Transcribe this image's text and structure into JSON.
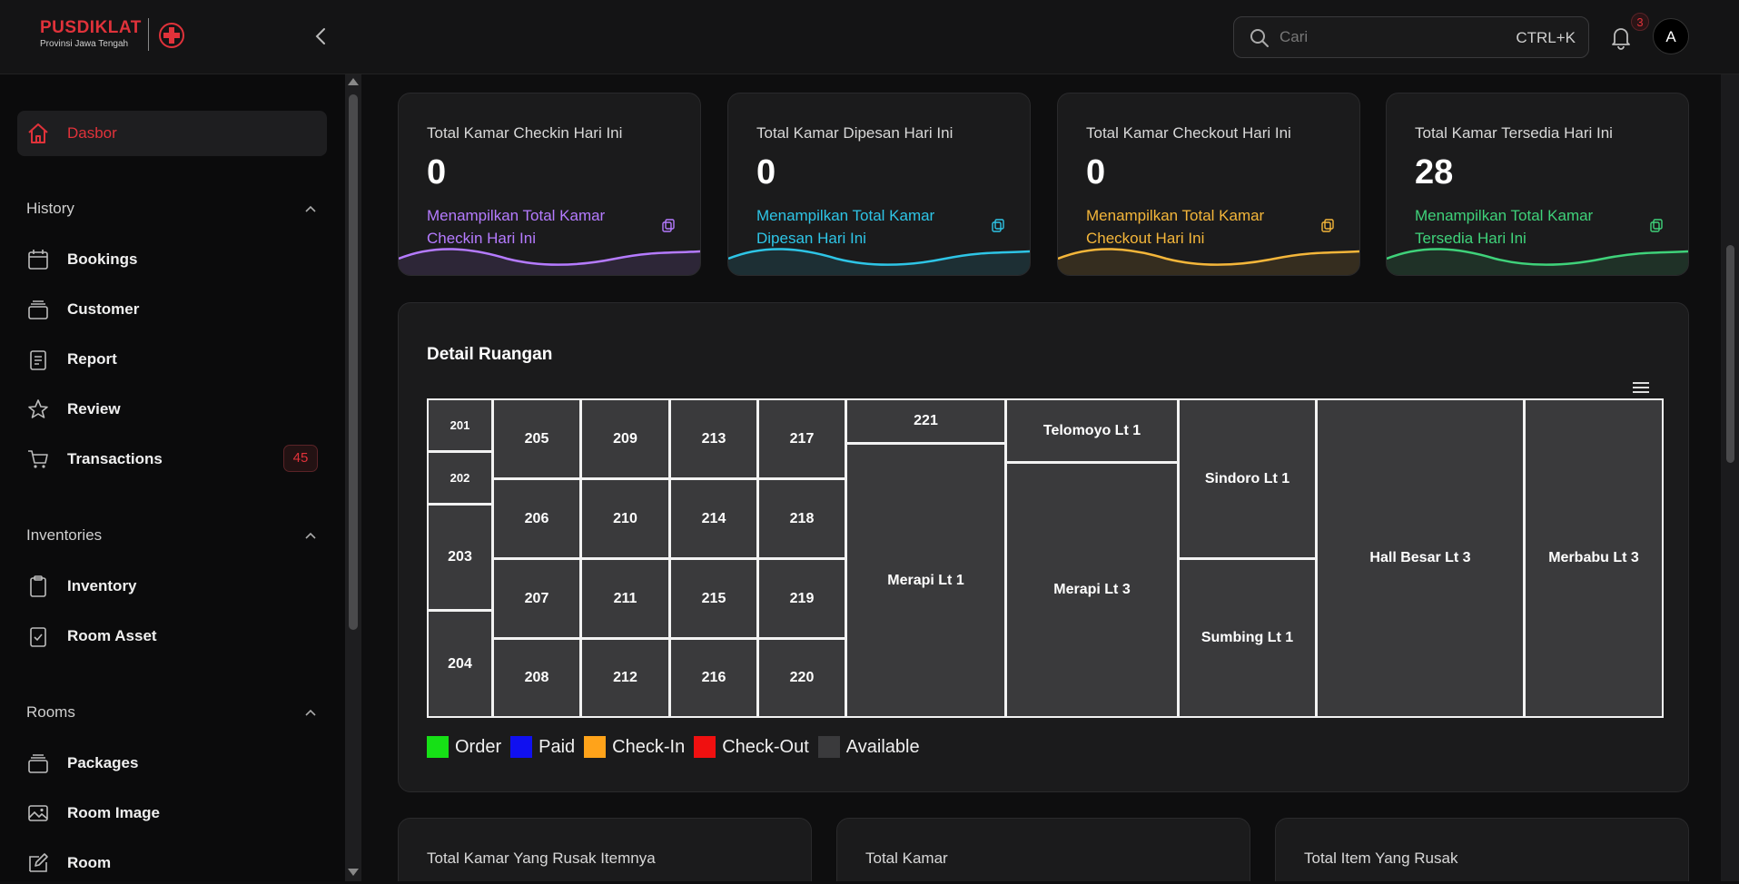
{
  "brand": {
    "title": "PUSDIKLAT",
    "subtitle": "Provinsi Jawa Tengah",
    "accent": "#e0323a"
  },
  "search": {
    "placeholder": "Cari",
    "shortcut": "CTRL+K"
  },
  "notifications": {
    "count": "3"
  },
  "user": {
    "initial": "A"
  },
  "sidebar": {
    "active": {
      "label": "Dasbor",
      "icon": "home-icon"
    },
    "sections": [
      {
        "title": "History",
        "items": [
          {
            "label": "Bookings",
            "icon": "calendar-icon"
          },
          {
            "label": "Customer",
            "icon": "stack-icon"
          },
          {
            "label": "Report",
            "icon": "clipboard-icon"
          },
          {
            "label": "Review",
            "icon": "star-icon"
          },
          {
            "label": "Transactions",
            "icon": "cart-icon",
            "badge": "45"
          }
        ]
      },
      {
        "title": "Inventories",
        "items": [
          {
            "label": "Inventory",
            "icon": "clipboard-icon"
          },
          {
            "label": "Room Asset",
            "icon": "clipboard-check-icon"
          }
        ]
      },
      {
        "title": "Rooms",
        "items": [
          {
            "label": "Packages",
            "icon": "stack-icon"
          },
          {
            "label": "Room Image",
            "icon": "image-icon"
          },
          {
            "label": "Room",
            "icon": "edit-icon"
          }
        ]
      }
    ]
  },
  "stats": [
    {
      "title": "Total Kamar Checkin Hari Ini",
      "value": "0",
      "desc": "Menampilkan Total Kamar Checkin Hari Ini",
      "color": "#b57bff"
    },
    {
      "title": "Total Kamar Dipesan Hari Ini",
      "value": "0",
      "desc": "Menampilkan Total Kamar Dipesan Hari Ini",
      "color": "#2ec5e6"
    },
    {
      "title": "Total Kamar Checkout Hari Ini",
      "value": "0",
      "desc": "Menampilkan Total Kamar Checkout Hari Ini",
      "color": "#f4b63a"
    },
    {
      "title": "Total Kamar Tersedia Hari Ini",
      "value": "28",
      "desc": "Menampilkan Total Kamar Tersedia Hari Ini",
      "color": "#3fd27a"
    }
  ],
  "detail": {
    "title": "Detail Ruangan",
    "rooms": [
      "201",
      "202",
      "203",
      "204",
      "205",
      "206",
      "207",
      "208",
      "209",
      "210",
      "211",
      "212",
      "213",
      "214",
      "215",
      "216",
      "217",
      "218",
      "219",
      "220",
      "221",
      "Merapi Lt 1",
      "Telomoyo Lt 1",
      "Merapi Lt 3",
      "Sindoro Lt 1",
      "Sumbing Lt 1",
      "Hall Besar Lt 3",
      "Merbabu Lt 3"
    ],
    "legend": [
      {
        "label": "Order",
        "color": "#16e016"
      },
      {
        "label": "Paid",
        "color": "#1010f0"
      },
      {
        "label": "Check-In",
        "color": "#ffa31a"
      },
      {
        "label": "Check-Out",
        "color": "#f01010"
      },
      {
        "label": "Available",
        "color": "#3a3a3c"
      }
    ]
  },
  "bottom_cards": [
    {
      "title": "Total Kamar Yang Rusak Itemnya"
    },
    {
      "title": "Total Kamar"
    },
    {
      "title": "Total Item Yang Rusak"
    }
  ]
}
